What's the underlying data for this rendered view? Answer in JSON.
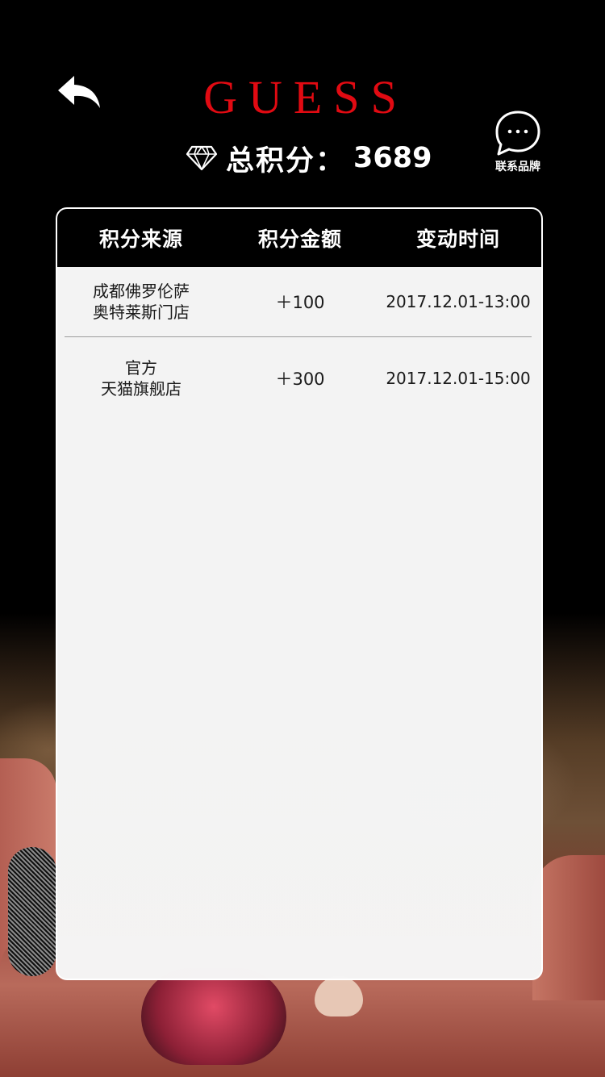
{
  "header": {
    "brand": "GUESS",
    "points_label": "总积分：",
    "points_value": "3689",
    "contact_label": "联系品牌",
    "brand_color": "#e10a12"
  },
  "icons": {
    "back": "back-arrow-icon",
    "diamond": "diamond-icon",
    "contact": "chat-bubble-icon"
  },
  "table": {
    "columns": [
      "积分来源",
      "积分金额",
      "变动时间"
    ],
    "rows": [
      {
        "source_line1": "成都佛罗伦萨",
        "source_line2": "奥特莱斯门店",
        "amount": "＋100",
        "time": "2017.12.01-13:00"
      },
      {
        "source_line1": "官方",
        "source_line2": "天猫旗舰店",
        "amount": "＋300",
        "time": "2017.12.01-15:00"
      }
    ]
  }
}
